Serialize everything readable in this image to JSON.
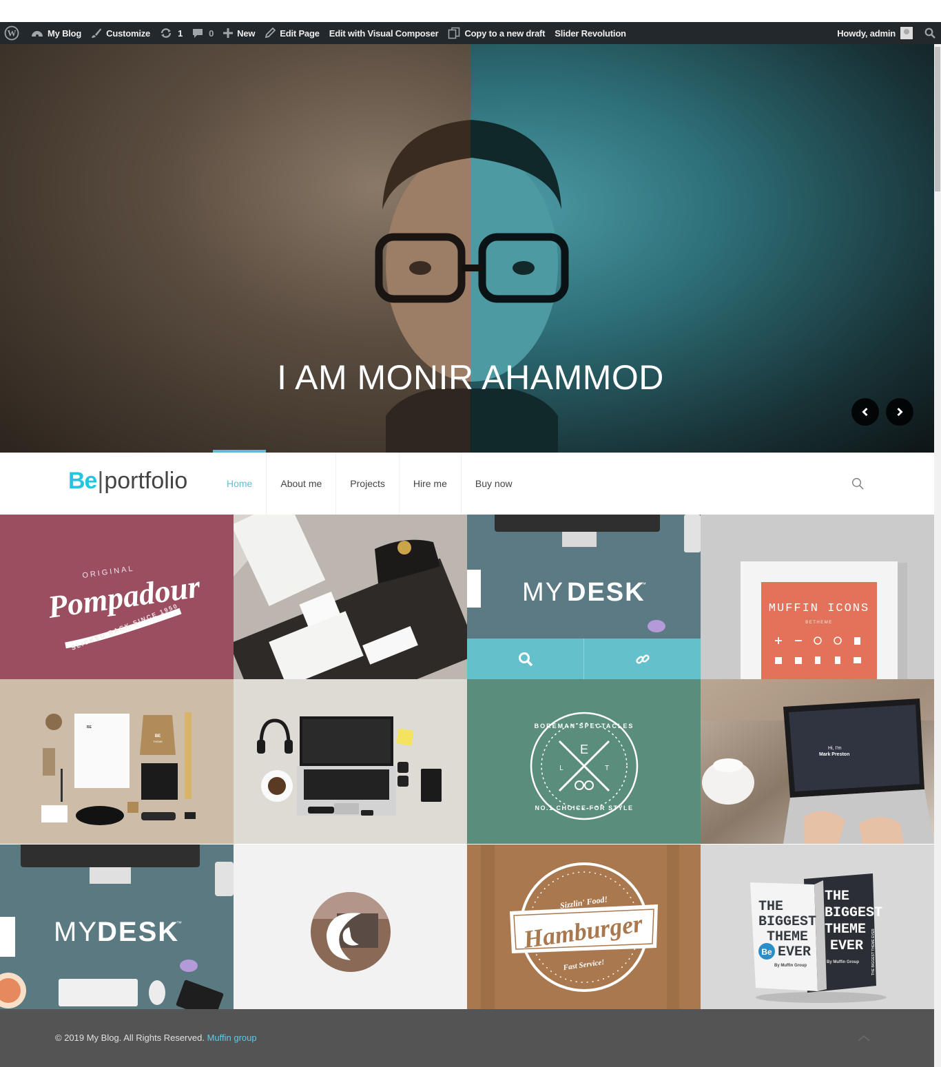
{
  "adminbar": {
    "items": [
      {
        "icon": "wordpress-icon",
        "label": ""
      },
      {
        "icon": "dashboard-icon",
        "label": "My Blog"
      },
      {
        "icon": "brush-icon",
        "label": "Customize"
      },
      {
        "icon": "updates-icon",
        "label": "1"
      },
      {
        "icon": "comment-icon",
        "label": "0"
      },
      {
        "icon": "plus-icon",
        "label": "New"
      },
      {
        "icon": "pencil-icon",
        "label": "Edit Page"
      },
      {
        "icon": "",
        "label": "Edit with Visual Composer"
      },
      {
        "icon": "copy-icon",
        "label": "Copy to a new draft"
      },
      {
        "icon": "",
        "label": "Slider Revolution"
      }
    ],
    "howdy": "Howdy, admin"
  },
  "hero": {
    "title": "I AM MONIR AHAMMOD"
  },
  "header": {
    "logo_be": "Be",
    "logo_sep": "|",
    "logo_word": "portfolio",
    "nav": [
      "Home",
      "About me",
      "Projects",
      "Hire me",
      "Buy now"
    ],
    "active_index": 0
  },
  "portfolio": {
    "tiles": [
      {
        "name": "pompadour",
        "lines": [
          "ORIGINAL",
          "Pompadour",
          "SLICKED BACK SINCE 1950"
        ]
      },
      {
        "name": "stationery",
        "lines": []
      },
      {
        "name": "mydesk-hover",
        "lines": [
          "MY",
          "DESK",
          "™"
        ]
      },
      {
        "name": "muffin-icons",
        "lines": [
          "MUFFIN ICONS",
          "BETHEME"
        ]
      },
      {
        "name": "branding-mockup",
        "lines": [
          "BE",
          "THEME"
        ]
      },
      {
        "name": "desk-flatlay",
        "lines": []
      },
      {
        "name": "boreman",
        "lines": [
          "BOREMAN SPECTACLES",
          "E",
          "L",
          "T",
          "NO.1 CHOICE FOR STYLE"
        ]
      },
      {
        "name": "laptop-photo",
        "lines": [
          "Hi, I'm",
          "Mark Preston"
        ]
      },
      {
        "name": "mydesk",
        "lines": [
          "MY",
          "DESK",
          "™"
        ]
      },
      {
        "name": "circle-logo",
        "lines": []
      },
      {
        "name": "hamburger",
        "lines": [
          "Sizzlin' Food!",
          "Hamburger",
          "Fast Service!"
        ]
      },
      {
        "name": "biggest-theme",
        "lines": [
          "THE",
          "BIGGEST",
          "THEME",
          "EVER",
          "Be",
          "By Muffin Group",
          "THE",
          "BIGGEST",
          "THEME",
          "EVER",
          "By Muffin Group",
          "THE BIGGEST THEME EVER"
        ]
      }
    ]
  },
  "footer": {
    "copyright": "© 2019 My Blog. All Rights Reserved.",
    "link": "Muffin group"
  },
  "colors": {
    "accent": "#5fbcd3",
    "logo_be": "#26c5df",
    "adminbar": "#23282d",
    "footer": "#545454"
  }
}
